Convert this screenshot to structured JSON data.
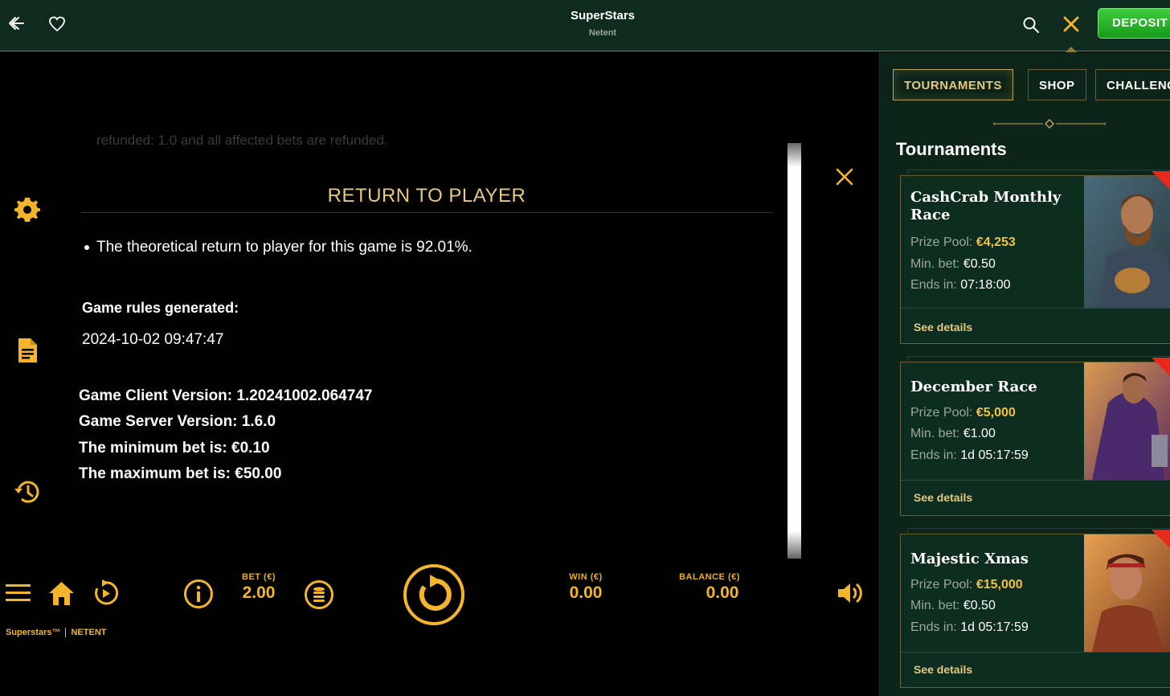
{
  "header": {
    "title": "SuperStars",
    "subtitle": "Netent",
    "deposit_label": "DEPOSIT"
  },
  "rules": {
    "ghost_text": "refunded: 1.0 and all affected bets are refunded.",
    "heading": "RETURN TO PLAYER",
    "rtp_text": "The theoretical return to player for this game is 92.01%.",
    "generated_label": "Game rules generated:",
    "generated_date": "2024-10-02 09:47:47",
    "client_version": "Game Client Version: 1.20241002.064747",
    "server_version": "Game Server Version: 1.6.0",
    "min_bet": "The minimum bet is: €0.10",
    "max_bet": "The maximum bet is: €50.00"
  },
  "controls": {
    "bet_label": "BET (€)",
    "bet_value": "2.00",
    "win_label": "WIN (€)",
    "win_value": "0.00",
    "balance_label": "BALANCE (€)",
    "balance_value": "0.00",
    "brand_game": "Superstars™",
    "brand_provider": "NETENT"
  },
  "panel": {
    "tabs": [
      "TOURNAMENTS",
      "SHOP",
      "CHALLENG"
    ],
    "title": "Tournaments",
    "prize_label": "Prize Pool:",
    "minbet_label": "Min. bet:",
    "ends_label": "Ends in:",
    "details_label": "See details",
    "cards": [
      {
        "name": "CashCrab Monthly Race",
        "prize": "€4,253",
        "min_bet": "€0.50",
        "ends": "07:18:00"
      },
      {
        "name": "December Race",
        "prize": "€5,000",
        "min_bet": "€1.00",
        "ends": "1d 05:17:59"
      },
      {
        "name": "Majestic Xmas",
        "prize": "€15,000",
        "min_bet": "€0.50",
        "ends": "1d 05:17:59"
      }
    ]
  },
  "colors": {
    "accent": "#f5b52a",
    "panel_bg": "#0c2419",
    "deposit_green": "#2cb52c"
  }
}
